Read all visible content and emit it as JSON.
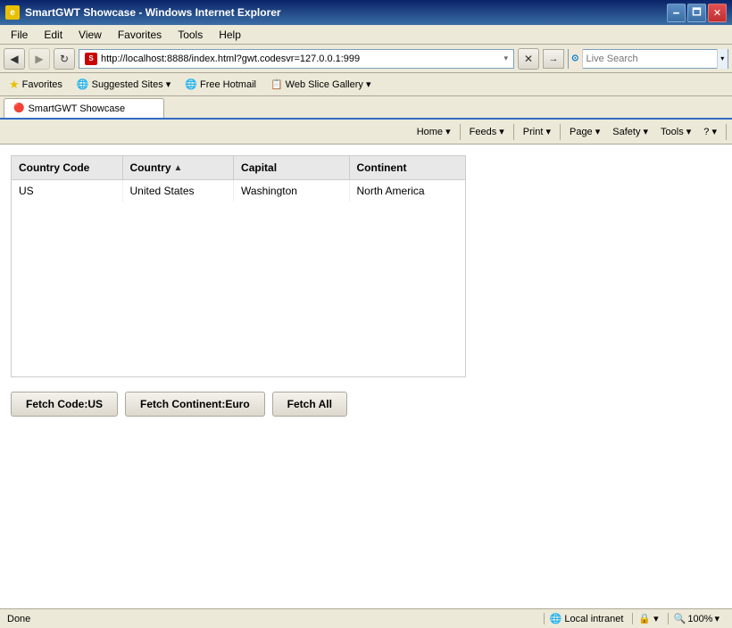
{
  "titleBar": {
    "title": "SmartGWT Showcase - Windows Internet Explorer",
    "minimize": "🗕",
    "maximize": "🗖",
    "close": "✕"
  },
  "menuBar": {
    "items": [
      "File",
      "Edit",
      "View",
      "Favorites",
      "Tools",
      "Help"
    ]
  },
  "addressBar": {
    "url": "http://localhost:8888/index.html?gwt.codesvr=127.0.0.1:999",
    "searchPlaceholder": "Live Search",
    "searchLabel": "Search",
    "goLabel": "→"
  },
  "favoritesBar": {
    "favoritesLabel": "Favorites",
    "items": [
      {
        "label": "Suggested Sites ▾",
        "icon": "🌐"
      },
      {
        "label": "Free Hotmail",
        "icon": "🌐"
      },
      {
        "label": "Web Slice Gallery ▾",
        "icon": "📋"
      }
    ]
  },
  "tabs": [
    {
      "label": "SmartGWT Showcase",
      "active": true,
      "favicon": "🔴"
    }
  ],
  "toolbar": {
    "buttons": [
      {
        "label": "Home ▾",
        "name": "home-button"
      },
      {
        "label": "Feeds ▾",
        "name": "feeds-button"
      },
      {
        "label": "Print ▾",
        "name": "print-button"
      },
      {
        "label": "Page ▾",
        "name": "page-button"
      },
      {
        "label": "Safety ▾",
        "name": "safety-button"
      },
      {
        "label": "Tools ▾",
        "name": "tools-button"
      },
      {
        "label": "? ▾",
        "name": "help-button"
      }
    ]
  },
  "grid": {
    "columns": [
      {
        "key": "countryCode",
        "label": "Country Code",
        "sorted": false
      },
      {
        "key": "country",
        "label": "Country",
        "sorted": true,
        "sortDir": "asc"
      },
      {
        "key": "capital",
        "label": "Capital",
        "sorted": false
      },
      {
        "key": "continent",
        "label": "Continent",
        "sorted": false
      }
    ],
    "rows": [
      {
        "countryCode": "US",
        "country": "United States",
        "capital": "Washington",
        "continent": "North America"
      }
    ]
  },
  "buttons": [
    {
      "label": "Fetch Code:US",
      "name": "fetch-code-btn"
    },
    {
      "label": "Fetch Continent:Euro",
      "name": "fetch-continent-btn"
    },
    {
      "label": "Fetch All",
      "name": "fetch-all-btn"
    }
  ],
  "statusBar": {
    "status": "Done",
    "zone": "Local intranet",
    "zoom": "100%",
    "zoneIcon": "🌐"
  }
}
